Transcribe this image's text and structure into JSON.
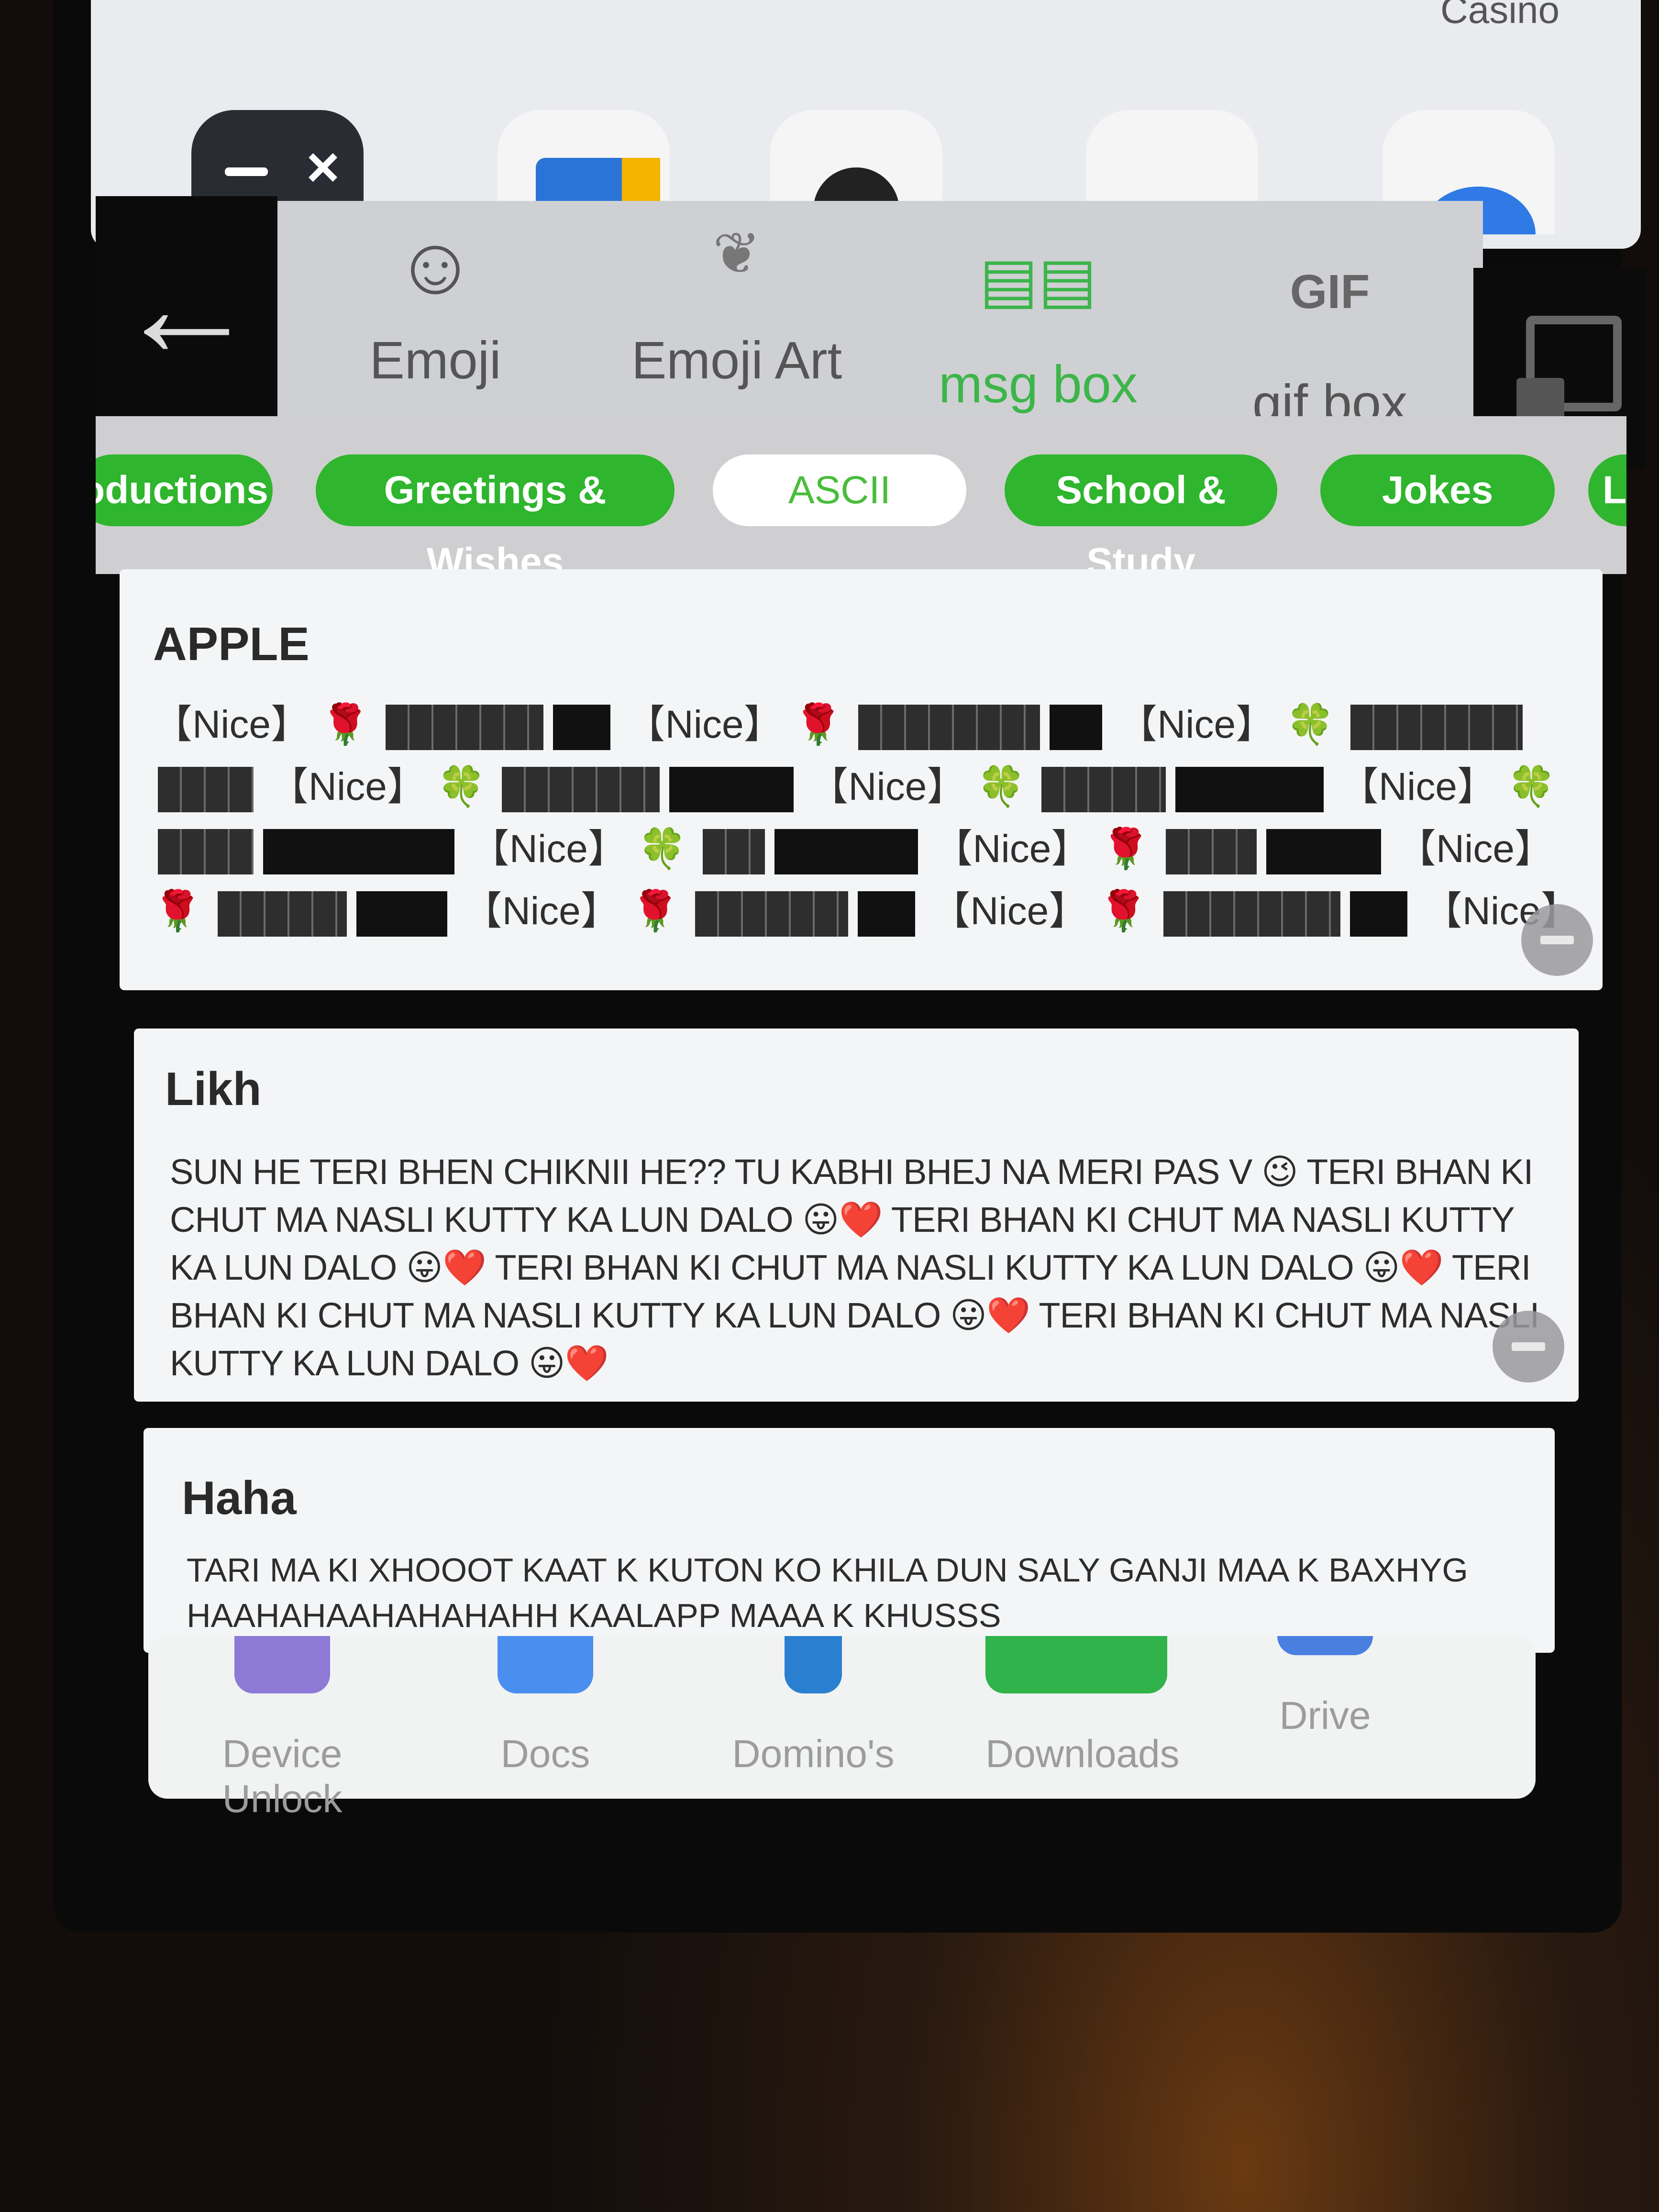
{
  "home_screen": {
    "top_label": "Casino"
  },
  "keyboard_tabs": [
    {
      "label": "Emoji",
      "icon": "smiley-face-icon"
    },
    {
      "label": "Emoji Art",
      "icon": "heart-art-icon"
    },
    {
      "label": "msg box",
      "icon": "chat-bubbles-icon",
      "active": true
    },
    {
      "label": "gif box",
      "icon": "gif-icon",
      "icon_text": "GIF"
    }
  ],
  "categories": [
    "oductions",
    "Greetings & Wishes",
    "ASCII",
    "School & Study",
    "Jokes",
    "L"
  ],
  "selected_category": "ASCII",
  "cards": {
    "apple": {
      "title": "APPLE",
      "nice": "【Nice】",
      "rose": "🌹",
      "clover": "🍀"
    },
    "likh": {
      "title": "Likh",
      "body": "SUN HE TERI BHEN CHIKNII HE?? TU KABHI BHEJ NA MERI PAS V 😉 TERI BHAN KI CHUT MA NASLI KUTTY KA LUN DALO 😛❤️ TERI BHAN KI CHUT MA NASLI KUTTY KA LUN DALO 😛❤️ TERI BHAN KI CHUT MA NASLI KUTTY KA LUN DALO 😛❤️ TERI BHAN KI CHUT MA NASLI KUTTY KA LUN DALO 😛❤️ TERI BHAN KI CHUT MA NASLI KUTTY KA LUN DALO 😛❤️"
    },
    "haha": {
      "title": "Haha",
      "body": "TARI MA KI XHOOOT KAAT K KUTON KO KHILA DUN SALY GANJI MAA K BAXHYG HAAHAHAAHAHAHAHH KAALAPP MAAA K KHUSSS"
    }
  },
  "dock": [
    "Device Unlock",
    "Docs",
    "Domino's",
    "Downloads",
    "Drive"
  ],
  "colors": {
    "accent_green": "#2fb52e",
    "active_tab": "#3cb54a",
    "rose": "#d40d0d",
    "clover": "#2ea22e"
  }
}
